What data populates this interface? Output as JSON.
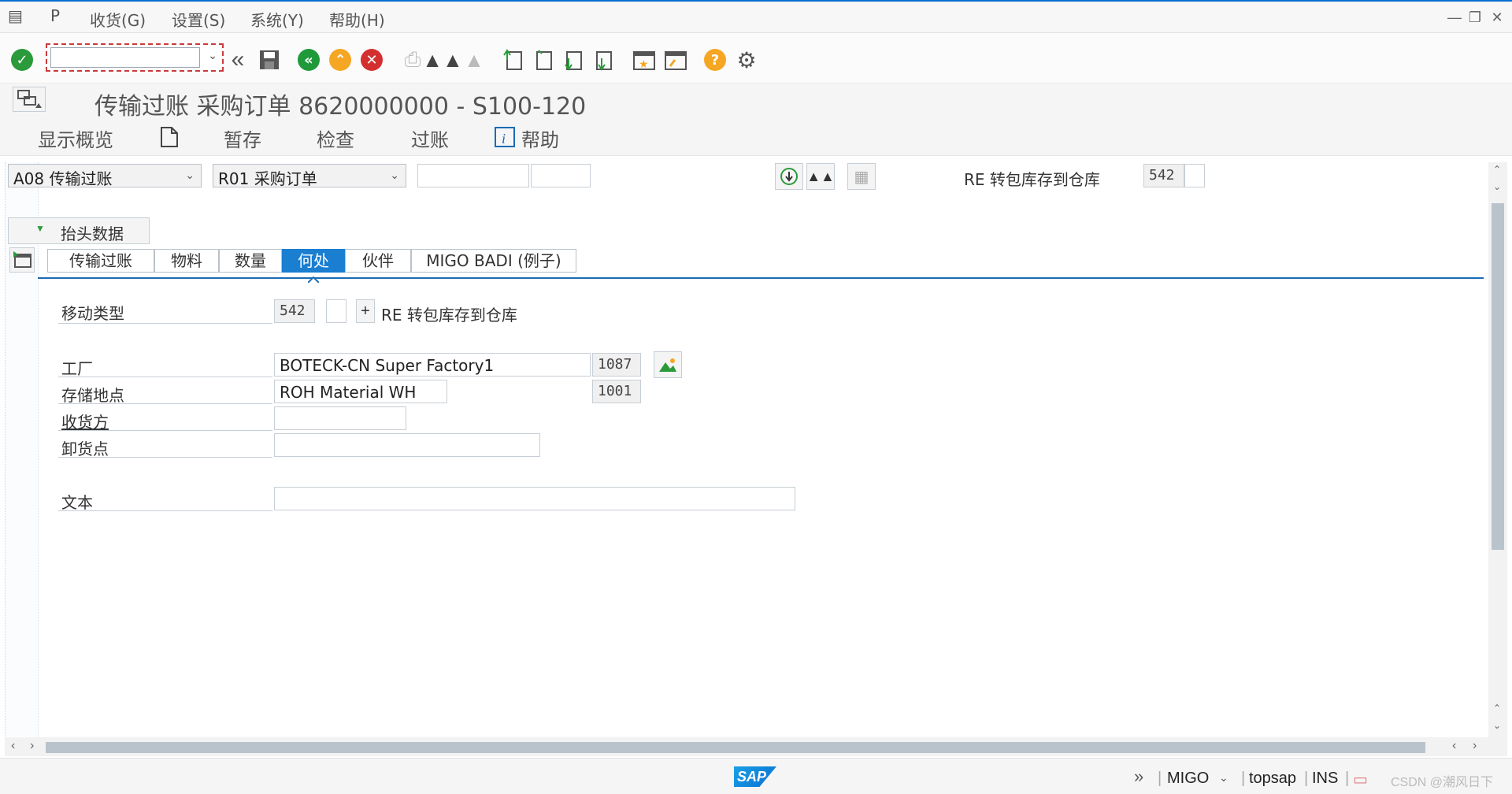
{
  "menu": {
    "items": [
      "收货(G)",
      "设置(S)",
      "系统(Y)",
      "帮助(H)"
    ]
  },
  "title": "传输过账 采购订单 8620000000 - S100-120",
  "app_toolbar": {
    "overview": "显示概览",
    "hold": "暂存",
    "check": "检查",
    "post": "过账",
    "help": "帮助"
  },
  "selection": {
    "action": "A08 传输过账",
    "reference": "R01 采购订单",
    "movement_text": "RE 转包库存到仓库",
    "movement_type": "542"
  },
  "header_data_label": "抬头数据",
  "tabs": [
    "传输过账",
    "物料",
    "数量",
    "何处",
    "伙伴",
    "MIGO BADI (例子)"
  ],
  "active_tab": "何处",
  "where": {
    "movement_type_label": "移动类型",
    "movement_type_value": "542",
    "plus_label": "+",
    "movement_desc": "RE 转包库存到仓库",
    "plant_label": "工厂",
    "plant_name": "BOTECK-CN Super Factory1",
    "plant_code": "1087",
    "sloc_label": "存储地点",
    "sloc_name": "ROH Material WH",
    "sloc_code": "1001",
    "recipient_label": "收货方",
    "recipient_value": "",
    "unloading_label": "卸货点",
    "unloading_value": "",
    "text_label": "文本",
    "text_value": ""
  },
  "status": {
    "transaction": "MIGO",
    "system": "topsap",
    "mode": "INS",
    "watermark": "CSDN @潮风日下"
  },
  "colors": {
    "accent": "#1a7ed1",
    "ok": "#2a9a3a",
    "back": "#1f9a3a",
    "exit": "#f5a623",
    "cancel": "#d42f2f",
    "help": "#f5a623"
  }
}
